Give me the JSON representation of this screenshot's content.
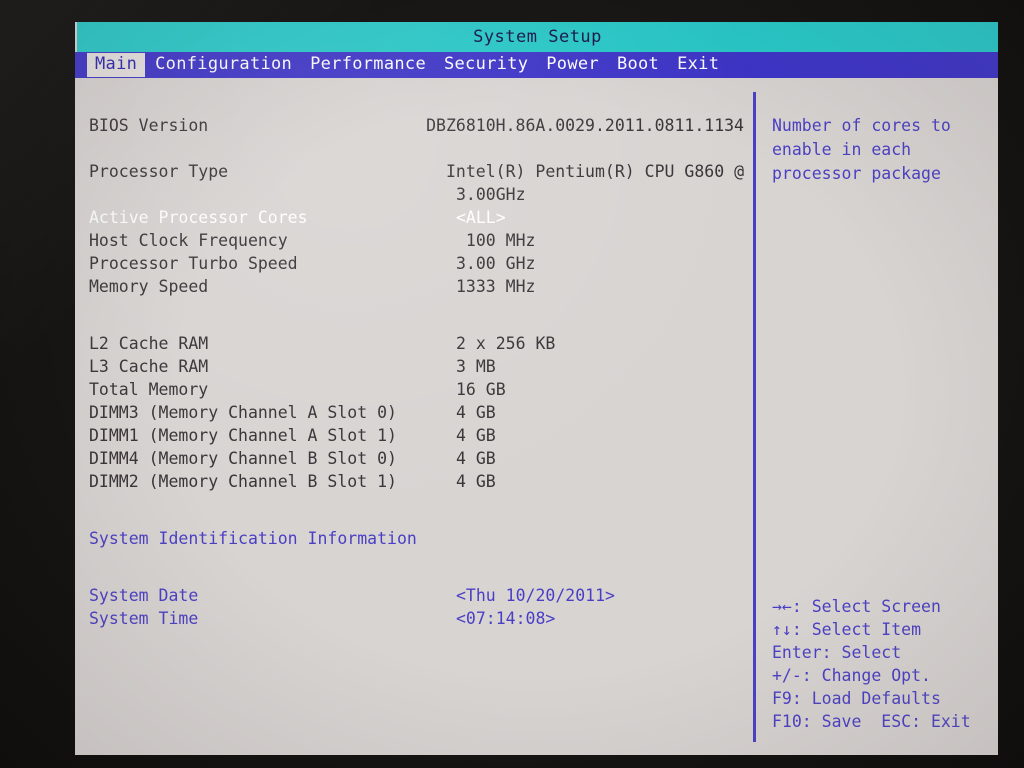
{
  "window": {
    "title": "System Setup"
  },
  "menu": {
    "items": [
      {
        "label": "Main",
        "active": true
      },
      {
        "label": "Configuration",
        "active": false
      },
      {
        "label": "Performance",
        "active": false
      },
      {
        "label": "Security",
        "active": false
      },
      {
        "label": "Power",
        "active": false
      },
      {
        "label": "Boot",
        "active": false
      },
      {
        "label": "Exit",
        "active": false
      }
    ]
  },
  "main": {
    "rows": {
      "bios_version_label": "BIOS Version",
      "bios_version_value": "DBZ6810H.86A.0029.2011.0811.1134",
      "processor_type_label": "Processor Type",
      "processor_type_value": "Intel(R) Pentium(R) CPU G860 @",
      "processor_type_value_cont": "3.00GHz",
      "active_cores_label": "Active Processor Cores",
      "active_cores_value": "<ALL>",
      "host_clock_label": "Host Clock Frequency",
      "host_clock_value": " 100 MHz",
      "turbo_speed_label": "Processor Turbo Speed",
      "turbo_speed_value": "3.00 GHz",
      "memory_speed_label": "Memory Speed",
      "memory_speed_value": "1333 MHz",
      "l2_cache_label": "L2 Cache RAM",
      "l2_cache_value": "2 x 256 KB",
      "l3_cache_label": "L3 Cache RAM",
      "l3_cache_value": "3 MB",
      "total_memory_label": "Total Memory",
      "total_memory_value": "16 GB",
      "dimm3_label": "DIMM3 (Memory Channel A Slot 0)",
      "dimm3_value": "4 GB",
      "dimm1_label": "DIMM1 (Memory Channel A Slot 1)",
      "dimm1_value": "4 GB",
      "dimm4_label": "DIMM4 (Memory Channel B Slot 0)",
      "dimm4_value": "4 GB",
      "dimm2_label": "DIMM2 (Memory Channel B Slot 1)",
      "dimm2_value": "4 GB",
      "system_id_label": "System Identification Information",
      "system_date_label": "System Date",
      "system_date_value": "<Thu 10/20/2011>",
      "system_time_label": "System Time",
      "system_time_value": "<07:14:08>"
    }
  },
  "help": {
    "lines": [
      "Number of cores to",
      "enable in each",
      "processor package"
    ]
  },
  "legend": {
    "lines": [
      "→←: Select Screen",
      "↑↓: Select Item",
      "Enter: Select",
      "+/-: Change Opt.",
      "F9: Load Defaults",
      "F10: Save  ESC: Exit"
    ]
  },
  "colors": {
    "title_bar": "#25c9c9",
    "menu_bar": "#3b32c8",
    "screen_bg": "#d8d4d2",
    "accent": "#4a3fc4",
    "static_text": "#393236",
    "selected_text": "#ffffff"
  }
}
